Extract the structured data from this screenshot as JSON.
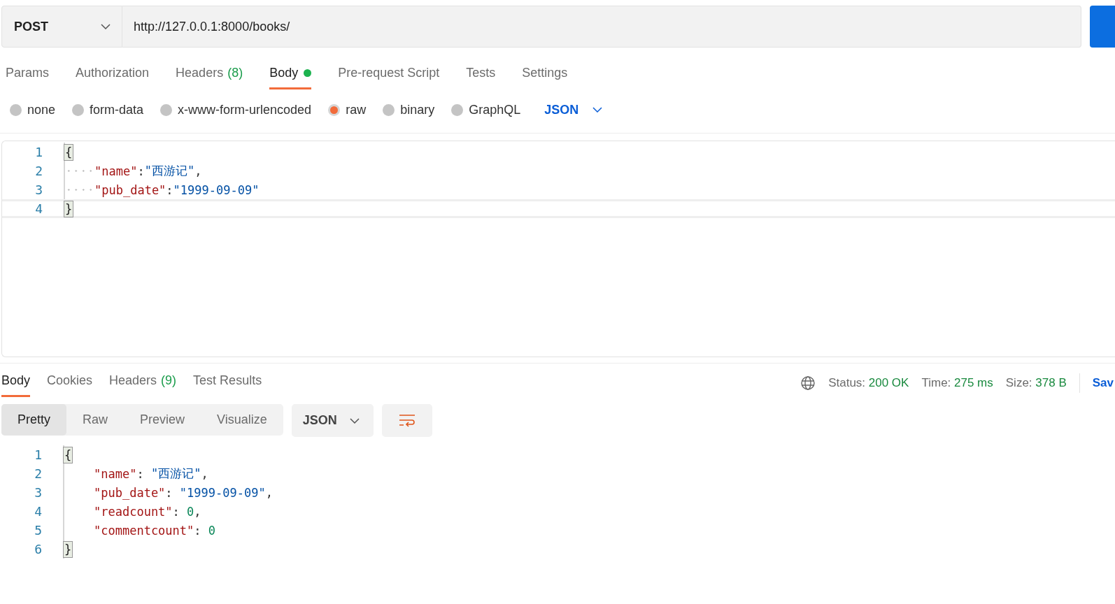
{
  "request": {
    "method": "POST",
    "url": "http://127.0.0.1:8000/books/"
  },
  "request_tabs": [
    {
      "label": "Params",
      "selected": false
    },
    {
      "label": "Authorization",
      "selected": false
    },
    {
      "label": "Headers",
      "count": "(8)",
      "selected": false
    },
    {
      "label": "Body",
      "dot": true,
      "selected": true
    },
    {
      "label": "Pre-request Script",
      "selected": false
    },
    {
      "label": "Tests",
      "selected": false
    },
    {
      "label": "Settings",
      "selected": false
    }
  ],
  "body_types": [
    {
      "label": "none",
      "selected": false
    },
    {
      "label": "form-data",
      "selected": false
    },
    {
      "label": "x-www-form-urlencoded",
      "selected": false
    },
    {
      "label": "raw",
      "selected": true
    },
    {
      "label": "binary",
      "selected": false
    },
    {
      "label": "GraphQL",
      "selected": false
    }
  ],
  "body_format": "JSON",
  "request_editor": {
    "show_whitespace": true,
    "lines": [
      {
        "number": "1",
        "indented": false,
        "tokens": [
          {
            "kind": "brace",
            "text": "{"
          }
        ]
      },
      {
        "number": "2",
        "indented": true,
        "tokens": [
          {
            "kind": "key",
            "text": "\"name\""
          },
          {
            "kind": "punct",
            "text": ":"
          },
          {
            "kind": "string",
            "text": "\"西游记\""
          },
          {
            "kind": "punct",
            "text": ","
          }
        ]
      },
      {
        "number": "3",
        "indented": true,
        "tokens": [
          {
            "kind": "key",
            "text": "\"pub_date\""
          },
          {
            "kind": "punct",
            "text": ":"
          },
          {
            "kind": "string",
            "text": "\"1999-09-09\""
          }
        ]
      },
      {
        "number": "4",
        "indented": false,
        "tokens": [
          {
            "kind": "brace",
            "text": "}"
          }
        ]
      }
    ]
  },
  "response_tabs": [
    {
      "label": "Body",
      "selected": true
    },
    {
      "label": "Cookies",
      "selected": false
    },
    {
      "label": "Headers",
      "count": "(9)",
      "selected": false
    },
    {
      "label": "Test Results",
      "selected": false
    }
  ],
  "response_meta": [
    {
      "label": "Status:",
      "value": "200 OK"
    },
    {
      "label": "Time:",
      "value": "275 ms"
    },
    {
      "label": "Size:",
      "value": "378 B"
    }
  ],
  "save_button": "Sav",
  "view_modes": [
    {
      "label": "Pretty",
      "selected": true
    },
    {
      "label": "Raw",
      "selected": false
    },
    {
      "label": "Preview",
      "selected": false
    },
    {
      "label": "Visualize",
      "selected": false
    }
  ],
  "response_format": "JSON",
  "response_editor": {
    "show_whitespace": false,
    "lines": [
      {
        "number": "1",
        "indented": false,
        "tokens": [
          {
            "kind": "brace",
            "text": "{"
          }
        ]
      },
      {
        "number": "2",
        "indented": true,
        "tokens": [
          {
            "kind": "key",
            "text": "\"name\""
          },
          {
            "kind": "punct",
            "text": ": "
          },
          {
            "kind": "string",
            "text": "\"西游记\""
          },
          {
            "kind": "punct",
            "text": ","
          }
        ]
      },
      {
        "number": "3",
        "indented": true,
        "tokens": [
          {
            "kind": "key",
            "text": "\"pub_date\""
          },
          {
            "kind": "punct",
            "text": ": "
          },
          {
            "kind": "string",
            "text": "\"1999-09-09\""
          },
          {
            "kind": "punct",
            "text": ","
          }
        ]
      },
      {
        "number": "4",
        "indented": true,
        "tokens": [
          {
            "kind": "key",
            "text": "\"readcount\""
          },
          {
            "kind": "punct",
            "text": ": "
          },
          {
            "kind": "number",
            "text": "0"
          },
          {
            "kind": "punct",
            "text": ","
          }
        ]
      },
      {
        "number": "5",
        "indented": true,
        "tokens": [
          {
            "kind": "key",
            "text": "\"commentcount\""
          },
          {
            "kind": "punct",
            "text": ": "
          },
          {
            "kind": "number",
            "text": "0"
          }
        ]
      },
      {
        "number": "6",
        "indented": false,
        "tokens": [
          {
            "kind": "brace",
            "text": "}"
          }
        ]
      }
    ]
  }
}
